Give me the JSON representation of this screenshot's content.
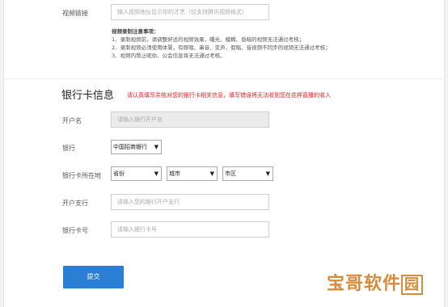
{
  "video": {
    "label": "视频链接",
    "placeholder": "输入视频地址显示你的才艺（仅支持腾讯视频格式）",
    "notes_title": "视频录制注意事项：",
    "notes": [
      "1、录制视频前，请调整好适的视频效果，曝光、模糊、昏暗的视频无法通过考核；",
      "2、录制视频必须使用体慧，有原唱、串音、变声、假唱、音视频不同步的视频无法通过考核；",
      "3、视频内禁止昵你、公会信息将无法通过考核。"
    ]
  },
  "bank": {
    "title": "银行卡信息",
    "notice": "请认真填写并核对您的银行卡相关信息，填写错误将无法收到您在花样直播的收入",
    "holder_label": "开户名",
    "holder_placeholder": "请输入银行开户名",
    "bank_label": "银行",
    "bank_value": "中国招商银行",
    "location_label": "银行卡所在地",
    "province_value": "省份",
    "city_value": "城市",
    "district_value": "市区",
    "branch_label": "开户支行",
    "branch_placeholder": "请输入您的银行开户支行",
    "card_label": "银行卡号",
    "card_placeholder": "请输入银行卡号"
  },
  "submit_label": "提交",
  "watermark": {
    "text": "宝哥软件",
    "last": "园"
  },
  "icons": {
    "dropdown": "caret-down-icon"
  },
  "colors": {
    "accent": "#2a7fd4",
    "warning": "#e02020",
    "watermark": "#d98b3a"
  }
}
